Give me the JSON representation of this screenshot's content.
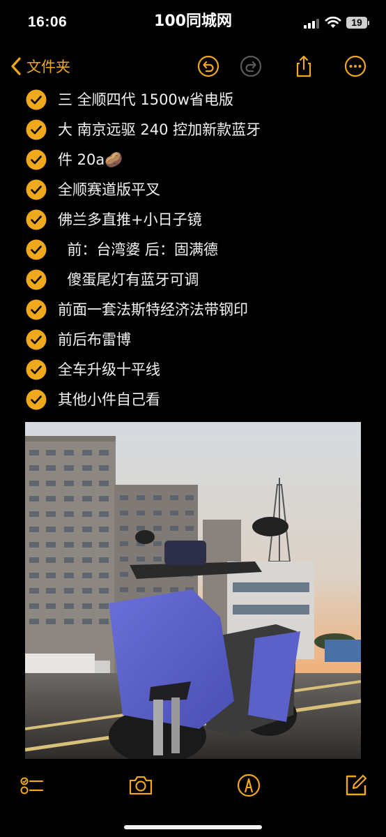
{
  "status_bar": {
    "time": "16:06",
    "center_text": "100同城网",
    "battery": "19"
  },
  "nav": {
    "back_label": "文件夹",
    "accent_color": "#f0a81c",
    "icons": [
      "chevron-left-icon",
      "undo-icon",
      "redo-icon",
      "share-icon",
      "more-icon"
    ]
  },
  "checklist": {
    "items": [
      {
        "text": "三 全顺四代 1500w省电版",
        "checked": true
      },
      {
        "text": "大 南京远驱 240 控加新款蓝牙",
        "checked": true
      },
      {
        "text": "件 20a🥔",
        "checked": true
      },
      {
        "text": "全顺赛道版平叉",
        "checked": true
      },
      {
        "text": "佛兰多直推+小日子镜",
        "checked": true
      },
      {
        "text": "  前：台湾婆 后：固满德",
        "checked": true
      },
      {
        "text": "  傻蛋尾灯有蓝牙可调",
        "checked": true
      },
      {
        "text": "前面一套法斯特经济法带钢印",
        "checked": true
      },
      {
        "text": "前后布雷博",
        "checked": true
      },
      {
        "text": "全车升级十平线",
        "checked": true
      },
      {
        "text": "其他小件自己看",
        "checked": true
      }
    ]
  },
  "photo": {
    "subject": "blue electric scooter at sunset with apartment buildings"
  },
  "toolbar": {
    "icons": [
      "checklist-icon",
      "camera-icon",
      "markup-pen-icon",
      "compose-icon"
    ]
  }
}
